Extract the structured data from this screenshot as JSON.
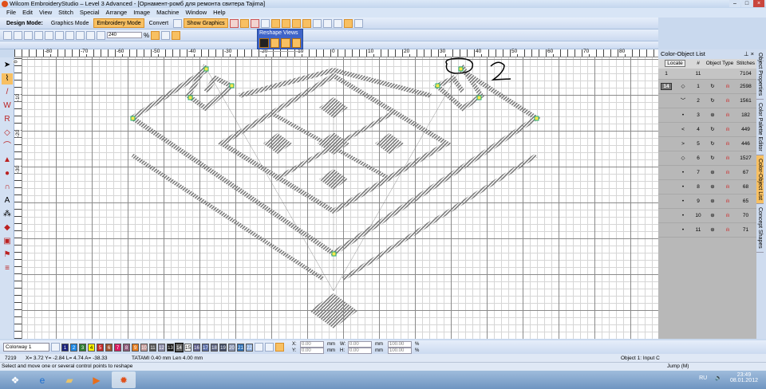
{
  "window": {
    "title": "Wilcom EmbroideryStudio – Level 3 Advanced - [Орнамент-ромб для ремонта свитера        Tajima]",
    "controls": [
      "–",
      "□",
      "×"
    ]
  },
  "menu": [
    "File",
    "Edit",
    "View",
    "Stitch",
    "Special",
    "Arrange",
    "Image",
    "Machine",
    "Window",
    "Help"
  ],
  "toolbar": {
    "design_mode_label": "Design Mode:",
    "graphics_mode": "Graphics Mode",
    "embroidery_mode": "Embroidery Mode",
    "convert": "Convert",
    "show_graphics": "Show Graphics",
    "zoom_value": "240",
    "zoom_unit": "%"
  },
  "reshape_views": {
    "title": "Reshape Views"
  },
  "rulers": {
    "top": [
      "-80",
      "-70",
      "-60",
      "-50",
      "-40",
      "-30",
      "-20",
      "-10",
      "0",
      "10",
      "20",
      "30",
      "40",
      "50",
      "60",
      "70",
      "80"
    ],
    "left": [
      "0",
      "-10",
      "-20",
      "-30"
    ]
  },
  "annotation": {
    "number": "2"
  },
  "panel": {
    "title": "Color-Object List",
    "pin": "⊥ ×",
    "locate": "Locate",
    "headers": [
      "#",
      "Object Type",
      "Stitches"
    ],
    "total": {
      "color": "1",
      "count": "11",
      "stitches": "7104"
    },
    "group": "14",
    "rows": [
      {
        "n": "1",
        "st": "2598"
      },
      {
        "n": "2",
        "st": "1561"
      },
      {
        "n": "3",
        "st": "182"
      },
      {
        "n": "4",
        "st": "449"
      },
      {
        "n": "5",
        "st": "446"
      },
      {
        "n": "6",
        "st": "1527"
      },
      {
        "n": "7",
        "st": "67"
      },
      {
        "n": "8",
        "st": "68"
      },
      {
        "n": "9",
        "st": "65"
      },
      {
        "n": "10",
        "st": "70"
      },
      {
        "n": "11",
        "st": "71"
      }
    ]
  },
  "side_tabs": [
    "Object Properties",
    "Color Palette Editor",
    "Color-Object List",
    "Concept Shapes"
  ],
  "colorbar": {
    "colorway": "Colorway 1",
    "swatches": [
      {
        "n": "1",
        "c": "#1a237e"
      },
      {
        "n": "2",
        "c": "#1e88e5"
      },
      {
        "n": "3",
        "c": "#2e7d32"
      },
      {
        "n": "4",
        "c": "#fff200"
      },
      {
        "n": "5",
        "c": "#c62828"
      },
      {
        "n": "6",
        "c": "#a0522d"
      },
      {
        "n": "7",
        "c": "#d81b60"
      },
      {
        "n": "8",
        "c": "#8e5a7a"
      },
      {
        "n": "9",
        "c": "#e67e22"
      },
      {
        "n": "10",
        "c": "#c49a9a"
      },
      {
        "n": "11",
        "c": "#555555"
      },
      {
        "n": "12",
        "c": "#8a8aa8"
      },
      {
        "n": "13",
        "c": "#111111"
      },
      {
        "n": "14",
        "c": "#666666"
      },
      {
        "n": "15",
        "c": "#ffffff"
      },
      {
        "n": "16",
        "c": "#5b5b8a"
      },
      {
        "n": "17",
        "c": "#5a6ea8"
      },
      {
        "n": "18",
        "c": "#5a6280"
      },
      {
        "n": "19",
        "c": "#3f4a66"
      },
      {
        "n": "20",
        "c": "#8a96b4"
      },
      {
        "n": "21",
        "c": "#2b6fb6"
      },
      {
        "n": "22",
        "c": "#8fb1e0"
      }
    ],
    "x_label": "X:",
    "x": "0.00",
    "y_label": "Y:",
    "y": "0.00",
    "w_label": "W:",
    "w": "0.00",
    "h_label": "H:",
    "h": "0.00",
    "unit": "mm",
    "pct1": "100.00",
    "pct2": "100.00",
    "pct": "%"
  },
  "status": {
    "stitch_count": "7219",
    "coords": "X=  3.72 Y=  -2.84 L=  4.74 A= -38.33",
    "stitch_info": "TATAMI 0.40 mm Len  4.00 mm",
    "object": "Object 1: Input C",
    "hint": "Select and move one or several control points to reshape",
    "jump": "Jump (M)"
  },
  "taskbar": {
    "lang": "RU",
    "time": "23:49",
    "date": "08.01.2012"
  }
}
